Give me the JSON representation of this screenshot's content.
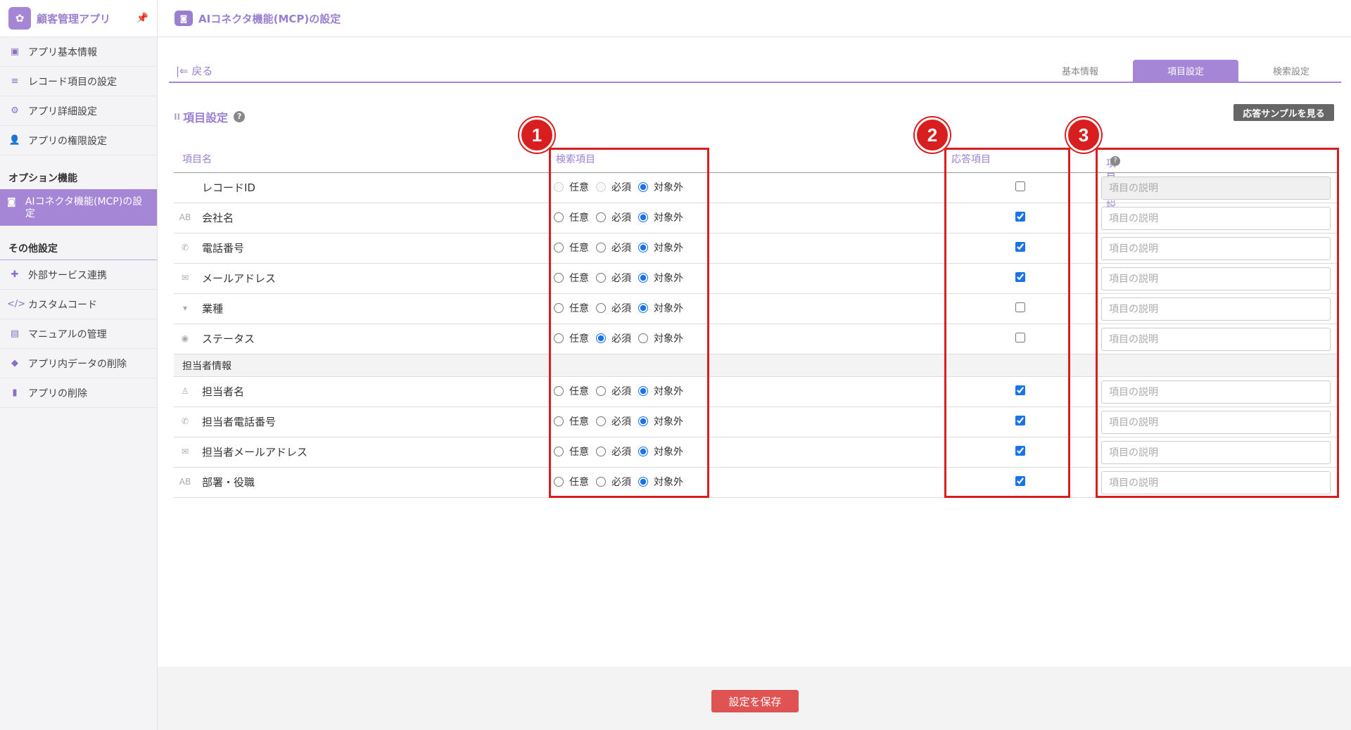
{
  "app": {
    "name": "顧客管理アプリ"
  },
  "header": {
    "title": "AIコネクタ機能(MCP)の設定"
  },
  "sidebar": {
    "items": [
      {
        "label": "アプリ基本情報"
      },
      {
        "label": "レコード項目の設定"
      },
      {
        "label": "アプリ詳細設定"
      },
      {
        "label": "アプリの権限設定"
      }
    ],
    "option_section": "オプション機能",
    "active_item": "AIコネクタ機能(MCP)の設定",
    "other_section": "その他設定",
    "other_items": [
      {
        "label": "外部サービス連携"
      },
      {
        "label": "カスタムコード"
      },
      {
        "label": "マニュアルの管理"
      },
      {
        "label": "アプリ内データの削除"
      },
      {
        "label": "アプリの削除"
      }
    ]
  },
  "nav": {
    "back": "戻る",
    "tabs": [
      "基本情報",
      "項目設定",
      "検索設定"
    ],
    "active_tab": "項目設定"
  },
  "section": {
    "title": "項目設定",
    "sample_button": "応答サンプルを見る"
  },
  "table": {
    "headers": {
      "name": "項目名",
      "search": "検索項目",
      "response": "応答項目",
      "description": "項目の説明"
    },
    "options": [
      "任意",
      "必須",
      "対象外"
    ],
    "description_placeholder": "項目の説明",
    "rows": [
      {
        "name": "レコードID",
        "icon": "none",
        "search": "対象外",
        "response": false,
        "disabled": true
      },
      {
        "name": "会社名",
        "icon": "text-field-icon",
        "search": "対象外",
        "response": true
      },
      {
        "name": "電話番号",
        "icon": "phone-icon",
        "search": "対象外",
        "response": true
      },
      {
        "name": "メールアドレス",
        "icon": "mail-icon",
        "search": "対象外",
        "response": true
      },
      {
        "name": "業種",
        "icon": "dropdown-icon",
        "search": "対象外",
        "response": false
      },
      {
        "name": "ステータス",
        "icon": "radio-icon",
        "search": "必須",
        "response": false
      },
      {
        "group": "担当者情報"
      },
      {
        "name": "担当者名",
        "icon": "user-icon",
        "search": "対象外",
        "response": true
      },
      {
        "name": "担当者電話番号",
        "icon": "phone-icon",
        "search": "対象外",
        "response": true
      },
      {
        "name": "担当者メールアドレス",
        "icon": "mail-icon",
        "search": "対象外",
        "response": true
      },
      {
        "name": "部署・役職",
        "icon": "text-field-icon",
        "search": "対象外",
        "response": true
      }
    ]
  },
  "annotations": [
    "1",
    "2",
    "3"
  ],
  "footer": {
    "save": "設定を保存"
  },
  "colors": {
    "accent": "#a585d6",
    "annotation": "#d81e1e",
    "save": "#e05353"
  }
}
